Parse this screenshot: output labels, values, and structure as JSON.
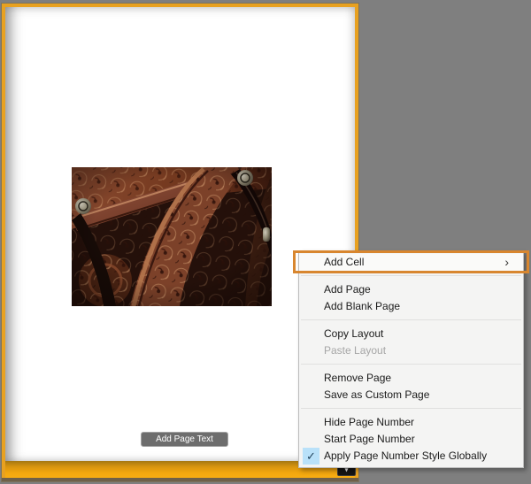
{
  "window": {
    "background_color": "#7f7f7f"
  },
  "page_editor": {
    "selected_page_frame_color": "#e8a120",
    "photo_cell": {
      "image_alt": "tooled-leather-western-saddle-photo"
    },
    "add_page_text_button_label": "Add Page Text",
    "page_bar_dropdown_icon": "▾"
  },
  "context_menu": {
    "highlight_color": "#d8862f",
    "icons": {
      "submenu_arrow": "›",
      "check": "✓"
    },
    "items": [
      {
        "label": "Add Cell",
        "has_submenu": true,
        "highlighted": true,
        "enabled": true
      },
      {
        "separator": true
      },
      {
        "label": "Add Page",
        "enabled": true
      },
      {
        "label": "Add Blank Page",
        "enabled": true
      },
      {
        "separator": true
      },
      {
        "label": "Copy Layout",
        "enabled": true
      },
      {
        "label": "Paste Layout",
        "enabled": false
      },
      {
        "separator": true
      },
      {
        "label": "Remove Page",
        "enabled": true
      },
      {
        "label": "Save as Custom Page",
        "enabled": true
      },
      {
        "separator": true
      },
      {
        "label": "Hide Page Number",
        "enabled": true
      },
      {
        "label": "Start Page Number",
        "enabled": true
      },
      {
        "label": "Apply Page Number Style Globally",
        "enabled": true,
        "checked": true
      }
    ]
  }
}
